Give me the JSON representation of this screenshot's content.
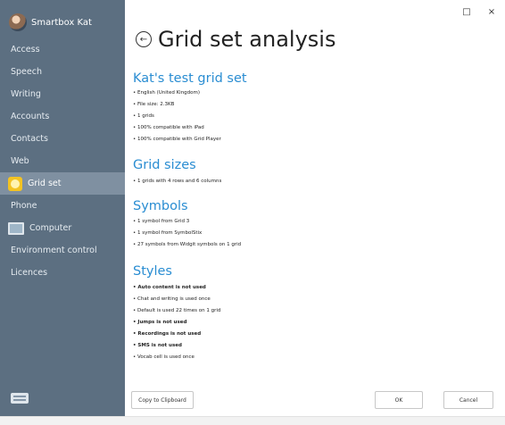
{
  "user": {
    "name": "Smartbox Kat"
  },
  "sidebar": {
    "items": [
      {
        "label": "Access"
      },
      {
        "label": "Speech"
      },
      {
        "label": "Writing"
      },
      {
        "label": "Accounts"
      },
      {
        "label": "Contacts"
      },
      {
        "label": "Web"
      },
      {
        "label": "Grid set"
      },
      {
        "label": "Phone"
      },
      {
        "label": "Computer"
      },
      {
        "label": "Environment control"
      },
      {
        "label": "Licences"
      }
    ]
  },
  "window": {
    "minimize": "□",
    "close": "×"
  },
  "page": {
    "title": "Grid set analysis",
    "sections": {
      "gridset": {
        "heading": "Kat's test grid set",
        "lines": [
          "• English (United Kingdom)",
          "• File size: 2.3KB",
          "• 1 grids",
          "• 100% compatible with iPad",
          "• 100% compatible with Grid Player"
        ]
      },
      "gridsizes": {
        "heading": "Grid sizes",
        "lines": [
          "• 1 grids with 4 rows and 6 columns"
        ]
      },
      "symbols": {
        "heading": "Symbols",
        "lines": [
          "• 1 symbol from Grid 3",
          "• 1 symbol from SymbolStix",
          "• 27 symbols from Widgit symbols on 1 grid"
        ]
      },
      "styles": {
        "heading": "Styles",
        "lines": [
          "• Auto content is not used",
          "• Chat and writing is used once",
          "• Default is used 22 times on 1 grid",
          "• Jumps is not used",
          "• Recordings is not used",
          "• SMS is not used",
          "• Vocab cell is used once"
        ]
      }
    }
  },
  "buttons": {
    "copy": "Copy to Clipboard",
    "ok": "OK",
    "cancel": "Cancel"
  }
}
